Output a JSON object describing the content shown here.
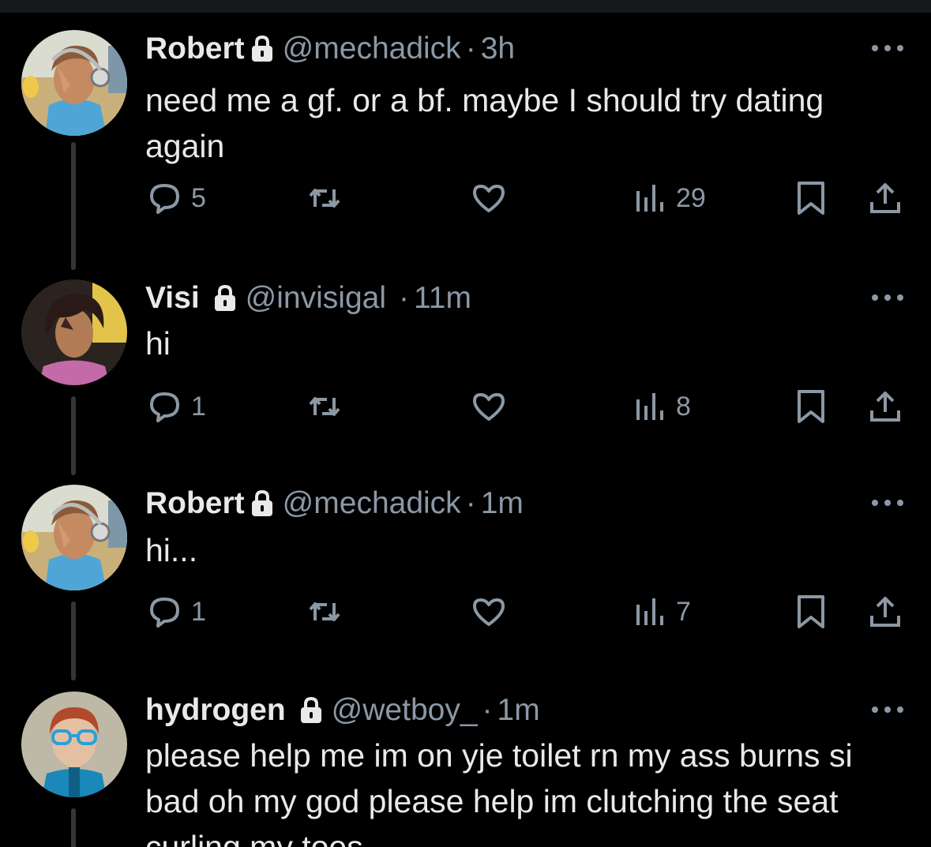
{
  "tweets": [
    {
      "name": "Robert",
      "handle": "@mechadick",
      "dot": "·",
      "time": "3h",
      "text": "need me a gf. or a bf. maybe I should try dating again",
      "replies": "5",
      "retweets": "",
      "likes": "",
      "views": "29"
    },
    {
      "name": "Visi",
      "handle": "@invisigal",
      "dot": "·",
      "time": "11m",
      "text": "hi",
      "replies": "1",
      "retweets": "",
      "likes": "",
      "views": "8"
    },
    {
      "name": "Robert",
      "handle": "@mechadick",
      "dot": "·",
      "time": "1m",
      "text": "hi...",
      "replies": "1",
      "retweets": "",
      "likes": "",
      "views": "7"
    },
    {
      "name": "hydrogen",
      "handle": "@wetboy_",
      "dot": "·",
      "time": "1m",
      "text": "please help me im on yje toilet rn my ass burns si bad oh my god please help im clutching the seat curling my toes"
    }
  ],
  "icons": {
    "lock": "lock-icon",
    "more": "more-icon",
    "reply": "reply-icon",
    "retweet": "retweet-icon",
    "like": "heart-icon",
    "views": "views-icon",
    "bookmark": "bookmark-icon",
    "share": "share-icon"
  },
  "colors": {
    "background": "#000000",
    "text": "#e7e9ea",
    "muted": "#8b98a5",
    "thread_line": "#333639"
  }
}
